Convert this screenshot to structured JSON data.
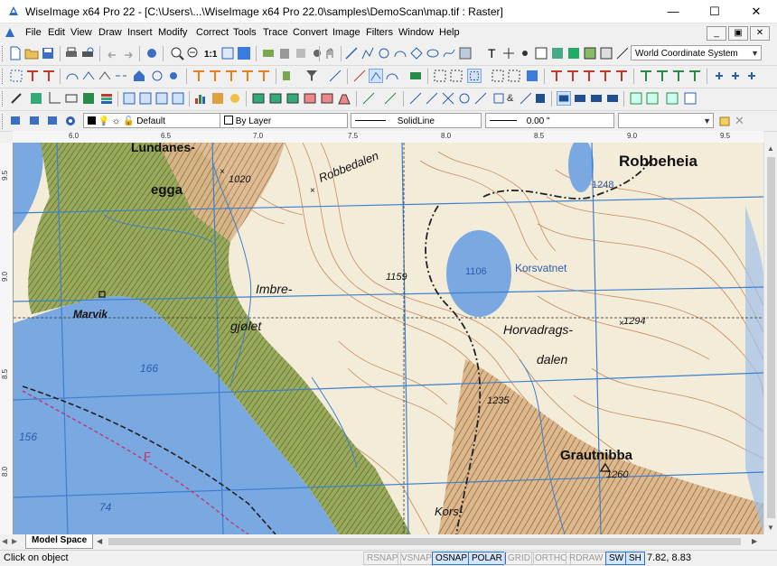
{
  "window": {
    "title": "WiseImage x64 Pro 22 - [C:\\Users\\...\\WiseImage x64 Pro 22.0\\samples\\DemoScan\\map.tif : Raster]",
    "minimize": "—",
    "maximize": "☐",
    "close": "✕"
  },
  "menu": {
    "items": [
      "File",
      "Edit",
      "View",
      "Draw",
      "Insert",
      "Modify",
      "Correct",
      "Tools",
      "Trace",
      "Convert",
      "Image",
      "Filters",
      "Window",
      "Help"
    ],
    "mdi_minimize": "_",
    "mdi_restore": "▣",
    "mdi_close": "✕"
  },
  "toolbar": {
    "zoom_label": "1:1",
    "coordinate_system": "World Coordinate System",
    "layer_name": "Default",
    "color_value": "By Layer",
    "linetype_value": "SolidLine",
    "lineweight_value": "0.00 \"",
    "style_value": ""
  },
  "rulers": {
    "horizontal": [
      "6.0",
      "6.5",
      "7.0",
      "7.5",
      "8.0",
      "8.5",
      "9.0",
      "9.5"
    ],
    "vertical": [
      "9.5",
      "9.0",
      "8.5",
      "8.0"
    ]
  },
  "map_labels": {
    "lundanes": "Lundanes-",
    "egga": "egga",
    "robbedalen": "Robbedalen",
    "robbeheia": "Robbeheia",
    "korsvatnet": "Korsvatnet",
    "marvik": "Marvik",
    "imbre": "Imbre-",
    "gjolet": "gjølet",
    "horvadrags": "Horvadrags-",
    "dalen": "dalen",
    "grautnibba": "Grautnibba",
    "kors": "Kors-",
    "h1020": "1020",
    "h1248": "1248",
    "h1159": "1159",
    "h1106": "1106",
    "h1294": "1294",
    "h1235": "1235",
    "h1260": "1260",
    "d166": "166",
    "d156": "156",
    "d74": "74",
    "f": "F"
  },
  "tabs": {
    "model_space": "Model Space"
  },
  "status": {
    "message": "Click on object",
    "toggles": [
      {
        "label": "RSNAP",
        "on": false
      },
      {
        "label": "VSNAP",
        "on": false
      },
      {
        "label": "OSNAP",
        "on": true
      },
      {
        "label": "POLAR",
        "on": true
      },
      {
        "label": "GRID",
        "on": false
      },
      {
        "label": "ORTHO",
        "on": false
      },
      {
        "label": "RDRAW",
        "on": false
      },
      {
        "label": "SW",
        "on": true
      },
      {
        "label": "SH",
        "on": true
      }
    ],
    "coordinates": "7.82, 8.83"
  },
  "colors": {
    "water": "#7aa8e0",
    "forest": "#6b8f3a",
    "contour": "#b8663a",
    "grid": "#3d7fd0",
    "trail": "#222222"
  }
}
